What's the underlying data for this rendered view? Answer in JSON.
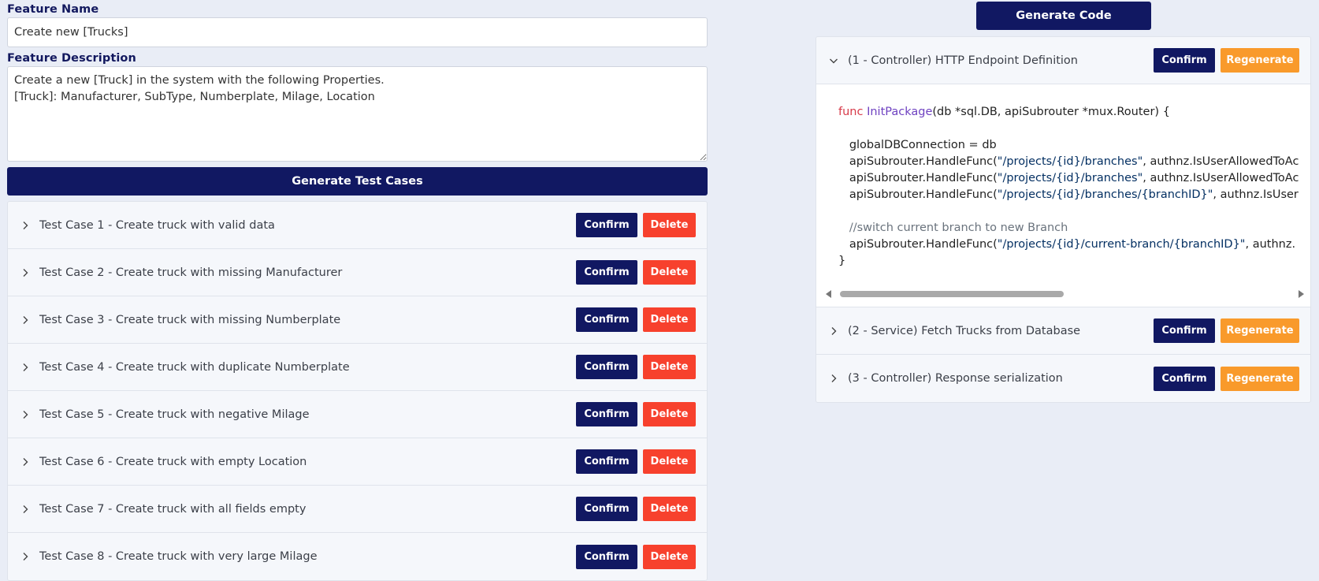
{
  "feature_name": {
    "label": "Feature Name",
    "value": "Create new [Trucks]"
  },
  "feature_description": {
    "label": "Feature Description",
    "value": "Create a new [Truck] in the system with the following Properties.\n[Truck]: Manufacturer, SubType, Numberplate, Milage, Location"
  },
  "generate_test_cases_label": "Generate Test Cases",
  "test_cases": [
    {
      "title": "Test Case 1 - Create truck with valid data",
      "confirm": "Confirm",
      "delete": "Delete"
    },
    {
      "title": "Test Case 2 - Create truck with missing Manufacturer",
      "confirm": "Confirm",
      "delete": "Delete"
    },
    {
      "title": "Test Case 3 - Create truck with missing Numberplate",
      "confirm": "Confirm",
      "delete": "Delete"
    },
    {
      "title": "Test Case 4 - Create truck with duplicate Numberplate",
      "confirm": "Confirm",
      "delete": "Delete"
    },
    {
      "title": "Test Case 5 - Create truck with negative Milage",
      "confirm": "Confirm",
      "delete": "Delete"
    },
    {
      "title": "Test Case 6 - Create truck with empty Location",
      "confirm": "Confirm",
      "delete": "Delete"
    },
    {
      "title": "Test Case 7 - Create truck with all fields empty",
      "confirm": "Confirm",
      "delete": "Delete"
    },
    {
      "title": "Test Case 8 - Create truck with very large Milage",
      "confirm": "Confirm",
      "delete": "Delete"
    }
  ],
  "generate_code_label": "Generate Code",
  "code_sections": [
    {
      "title": "(1 - Controller) HTTP Endpoint Definition",
      "confirm": "Confirm",
      "regenerate": "Regenerate",
      "expanded": true
    },
    {
      "title": "(2 - Service) Fetch Trucks from Database",
      "confirm": "Confirm",
      "regenerate": "Regenerate",
      "expanded": false
    },
    {
      "title": "(3 - Controller) Response serialization",
      "confirm": "Confirm",
      "regenerate": "Regenerate",
      "expanded": false
    }
  ],
  "code": {
    "l1_kw": "func",
    "l1_fn": "InitPackage",
    "l1_rest": "(db *sql.DB, apiSubrouter *mux.Router) {",
    "l2": "globalDBConnection = db",
    "l3_a": "apiSubrouter.HandleFunc(",
    "l3_str": "\"/projects/{id}/branches\"",
    "l3_b": ", authnz.IsUserAllowedToAc",
    "l4_a": "apiSubrouter.HandleFunc(",
    "l4_str": "\"/projects/{id}/branches\"",
    "l4_b": ", authnz.IsUserAllowedToAc",
    "l5_a": "apiSubrouter.HandleFunc(",
    "l5_str": "\"/projects/{id}/branches/{branchID}\"",
    "l5_b": ", authnz.IsUser",
    "l6_comment": "//switch current branch to new Branch",
    "l7_a": "apiSubrouter.HandleFunc(",
    "l7_str": "\"/projects/{id}/current-branch/{branchID}\"",
    "l7_b": ", authnz.",
    "l8": "}"
  },
  "icons": {
    "chevron_right": "chevron-right-icon",
    "chevron_down": "chevron-down-icon",
    "scroll_left": "triangle-left-icon",
    "scroll_right": "triangle-right-icon"
  },
  "colors": {
    "primary": "#111862",
    "delete": "#f7412d",
    "regenerate": "#f99a2b",
    "background": "#e9edf6"
  }
}
